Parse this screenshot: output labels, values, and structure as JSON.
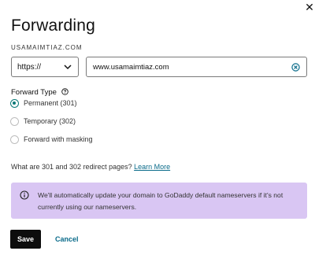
{
  "dialog": {
    "title": "Forwarding",
    "domain": "USAMAIMTIAZ.COM",
    "close_icon": "close-icon"
  },
  "form": {
    "protocol": {
      "selected": "https://",
      "icon": "chevron-down-icon"
    },
    "url": {
      "value": "www.usamaimtiaz.com",
      "clear_icon": "clear-circle-icon"
    },
    "forward_type": {
      "label": "Forward Type",
      "help_icon": "help-circle-icon",
      "options": [
        {
          "label": "Permanent (301)",
          "checked": true
        },
        {
          "label": "Temporary (302)",
          "checked": false
        },
        {
          "label": "Forward with masking",
          "checked": false
        }
      ]
    },
    "redirect_question": "What are 301 and 302 redirect pages?",
    "learn_more": "Learn More"
  },
  "banner": {
    "icon": "info-icon",
    "text": "We'll automatically update your domain to GoDaddy default nameservers if it's not currently using our nameservers.",
    "background": "#d9c6f3"
  },
  "actions": {
    "save_label": "Save",
    "cancel_label": "Cancel"
  },
  "colors": {
    "accent": "#0a7a78",
    "link": "#0a6b8a",
    "primary_button": "#0d0d0d"
  }
}
